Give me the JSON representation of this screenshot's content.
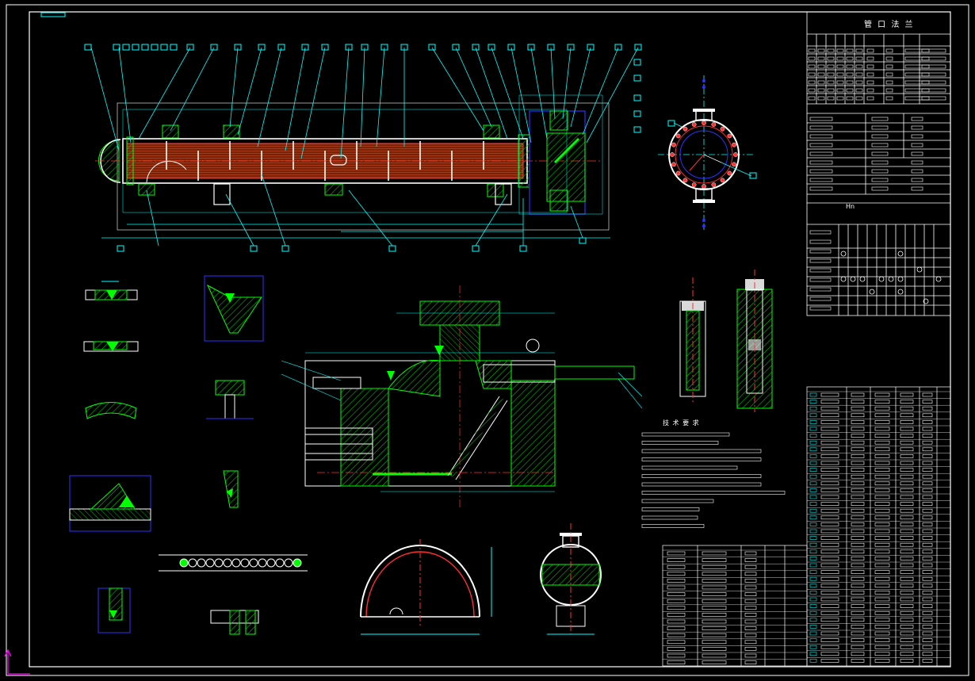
{
  "drawing": {
    "title_block_heading": "管 口 法 兰",
    "notes_heading": "技 术 要 求",
    "revision_mark": "Hn"
  },
  "nozzle_table": {
    "rows": [
      "a",
      "b",
      "c",
      "d",
      "e",
      "f",
      "g",
      "h"
    ]
  },
  "colors": {
    "background": "#000000",
    "frame": "#ffffff",
    "dimension": "#00ffff",
    "hatch_green": "#00ff00",
    "shell_red": "#ff3030",
    "section_blue": "#3030ff",
    "text_white": "#ffffff",
    "tube_brown": "#8b2a10",
    "ucs_magenta": "#ff00ff"
  }
}
